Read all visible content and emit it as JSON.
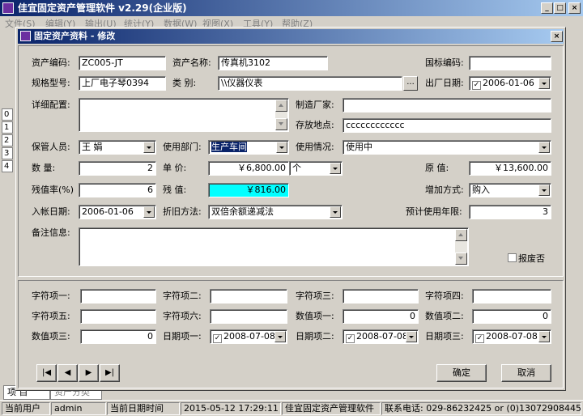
{
  "app": {
    "title": "佳宜固定资产管理软件 v2.29(企业版)",
    "menu": [
      "文件(S)",
      "编辑(Y)",
      "输出(U)",
      "统计(Y)",
      "数据(W)",
      "视图(X)",
      "工具(Y)",
      "帮助(Z)"
    ]
  },
  "left_rows": [
    "0",
    "1",
    "2",
    "3",
    "4"
  ],
  "bottom_tabs": [
    "项 目",
    "资产分类"
  ],
  "status": {
    "user_label": "当前用户",
    "user": "admin",
    "date_label": "当前日期时间",
    "datetime": "2015-05-12 17:29:11",
    "app_name": "佳宜固定资产管理软件",
    "phone": "联系电话: 029-86232425 or (0)13072908445"
  },
  "dialog": {
    "title": "固定资产资料 - 修改",
    "labels": {
      "asset_code": "资产编码:",
      "asset_name": "资产名称:",
      "national_code": "国标编码:",
      "spec_model": "规格型号:",
      "category": "类    别:",
      "factory_date": "出厂日期:",
      "detail_config": "详细配置:",
      "manufacturer": "制造厂家:",
      "location": "存放地点:",
      "keeper": "保管人员:",
      "department": "使用部门:",
      "usage": "使用情况:",
      "quantity": "数    量:",
      "unit_price": "单    价:",
      "original_value": "原    值:",
      "residual_rate": "残值率(%)",
      "residual_value": "残    值:",
      "increase_method": "增加方式:",
      "entry_date": "入帐日期:",
      "depreciation_method": "折旧方法:",
      "useful_years": "预计使用年限:",
      "remarks": "备注信息:",
      "scrapped": "报废否"
    },
    "values": {
      "asset_code": "ZC005-JT",
      "asset_name": "传真机3102",
      "national_code": "",
      "spec_model": "上厂电子琴0394",
      "category": "\\\\仪器仪表",
      "factory_date": "2006-01-06",
      "detail_config": "",
      "manufacturer": "",
      "location": "cccccccccccc",
      "keeper": "王 娟",
      "department": "生产车间",
      "usage": "使用中",
      "quantity": "2",
      "unit_price": "￥6,800.00",
      "unit": "个",
      "original_value": "￥13,600.00",
      "residual_rate": "6",
      "residual_value": "￥816.00",
      "increase_method": "购入",
      "entry_date": "2006-01-06",
      "depreciation_method": "双倍余额递减法",
      "useful_years": "3",
      "remarks": ""
    },
    "custom": {
      "str1_label": "字符项一:",
      "str2_label": "字符项二:",
      "str3_label": "字符项三:",
      "str4_label": "字符项四:",
      "str5_label": "字符项五:",
      "str6_label": "字符项六:",
      "num1_label": "数值项一:",
      "num2_label": "数值项二:",
      "num3_label": "数值项三:",
      "date1_label": "日期项一:",
      "date2_label": "日期项二:",
      "date3_label": "日期项三:",
      "num1": "0",
      "num2": "0",
      "num3": "0",
      "date1": "2008-07-08",
      "date2": "2008-07-08",
      "date3": "2008-07-08"
    },
    "nav": {
      "first": "|◀",
      "prev": "◀",
      "next": "▶",
      "last": "▶|"
    },
    "ok_label": "确定",
    "cancel_label": "取消",
    "ellipsis": "..."
  }
}
